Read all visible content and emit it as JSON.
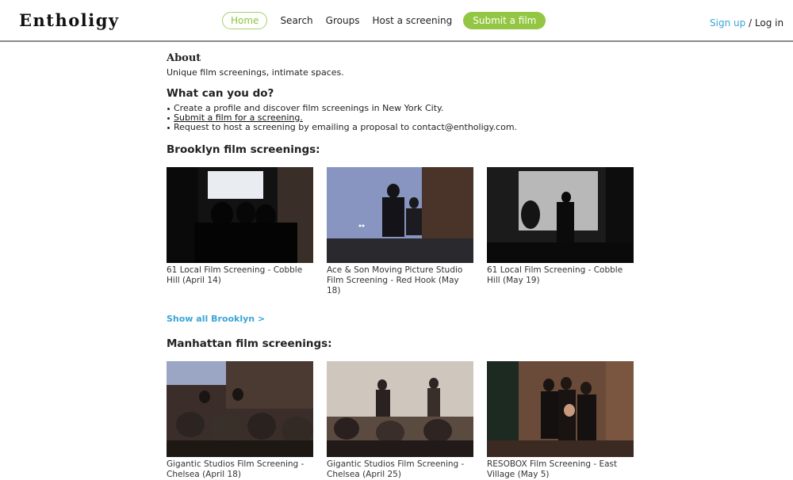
{
  "header": {
    "logo": "Entholigy",
    "nav": {
      "home": "Home",
      "search": "Search",
      "groups": "Groups",
      "host": "Host a screening",
      "submit": "Submit a film"
    },
    "auth": {
      "signup": "Sign up",
      "separator": " / ",
      "login": "Log in"
    }
  },
  "about": {
    "title": "About",
    "subtitle": "Unique film screenings, intimate spaces."
  },
  "what": {
    "title": "What can you do?",
    "items": [
      "Create a profile and discover film screenings in New York City.",
      "Submit a film for a screening.",
      "Request to host a screening by emailing a proposal to contact@entholigy.com."
    ]
  },
  "brooklyn": {
    "title": "Brooklyn film screenings:",
    "cards": [
      {
        "caption": "61 Local Film Screening - Cobble Hill (April 14)"
      },
      {
        "caption": "Ace & Son Moving Picture Studio Film Screening - Red Hook (May 18)"
      },
      {
        "caption": "61 Local Film Screening - Cobble Hill (May 19)"
      }
    ],
    "show_all": "Show all Brooklyn >"
  },
  "manhattan": {
    "title": "Manhattan film screenings:",
    "cards": [
      {
        "caption": "Gigantic Studios Film Screening - Chelsea (April 18)"
      },
      {
        "caption": "Gigantic Studios Film Screening - Chelsea (April 25)"
      },
      {
        "caption": "RESOBOX Film Screening - East Village (May 5)"
      }
    ]
  },
  "colors": {
    "accent_green": "#93c642",
    "link_blue": "#3ba4d6"
  }
}
